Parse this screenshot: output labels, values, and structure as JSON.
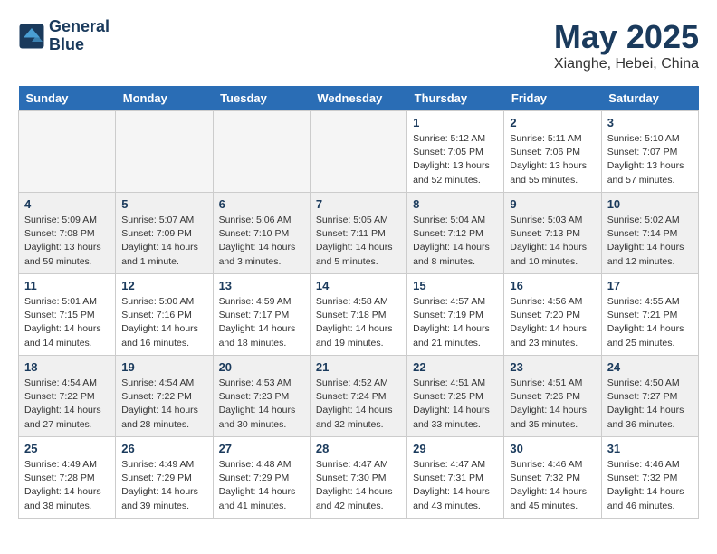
{
  "header": {
    "logo_line1": "General",
    "logo_line2": "Blue",
    "month": "May 2025",
    "location": "Xianghe, Hebei, China"
  },
  "weekdays": [
    "Sunday",
    "Monday",
    "Tuesday",
    "Wednesday",
    "Thursday",
    "Friday",
    "Saturday"
  ],
  "weeks": [
    [
      {
        "day": "",
        "info": ""
      },
      {
        "day": "",
        "info": ""
      },
      {
        "day": "",
        "info": ""
      },
      {
        "day": "",
        "info": ""
      },
      {
        "day": "1",
        "info": "Sunrise: 5:12 AM\nSunset: 7:05 PM\nDaylight: 13 hours\nand 52 minutes."
      },
      {
        "day": "2",
        "info": "Sunrise: 5:11 AM\nSunset: 7:06 PM\nDaylight: 13 hours\nand 55 minutes."
      },
      {
        "day": "3",
        "info": "Sunrise: 5:10 AM\nSunset: 7:07 PM\nDaylight: 13 hours\nand 57 minutes."
      }
    ],
    [
      {
        "day": "4",
        "info": "Sunrise: 5:09 AM\nSunset: 7:08 PM\nDaylight: 13 hours\nand 59 minutes."
      },
      {
        "day": "5",
        "info": "Sunrise: 5:07 AM\nSunset: 7:09 PM\nDaylight: 14 hours\nand 1 minute."
      },
      {
        "day": "6",
        "info": "Sunrise: 5:06 AM\nSunset: 7:10 PM\nDaylight: 14 hours\nand 3 minutes."
      },
      {
        "day": "7",
        "info": "Sunrise: 5:05 AM\nSunset: 7:11 PM\nDaylight: 14 hours\nand 5 minutes."
      },
      {
        "day": "8",
        "info": "Sunrise: 5:04 AM\nSunset: 7:12 PM\nDaylight: 14 hours\nand 8 minutes."
      },
      {
        "day": "9",
        "info": "Sunrise: 5:03 AM\nSunset: 7:13 PM\nDaylight: 14 hours\nand 10 minutes."
      },
      {
        "day": "10",
        "info": "Sunrise: 5:02 AM\nSunset: 7:14 PM\nDaylight: 14 hours\nand 12 minutes."
      }
    ],
    [
      {
        "day": "11",
        "info": "Sunrise: 5:01 AM\nSunset: 7:15 PM\nDaylight: 14 hours\nand 14 minutes."
      },
      {
        "day": "12",
        "info": "Sunrise: 5:00 AM\nSunset: 7:16 PM\nDaylight: 14 hours\nand 16 minutes."
      },
      {
        "day": "13",
        "info": "Sunrise: 4:59 AM\nSunset: 7:17 PM\nDaylight: 14 hours\nand 18 minutes."
      },
      {
        "day": "14",
        "info": "Sunrise: 4:58 AM\nSunset: 7:18 PM\nDaylight: 14 hours\nand 19 minutes."
      },
      {
        "day": "15",
        "info": "Sunrise: 4:57 AM\nSunset: 7:19 PM\nDaylight: 14 hours\nand 21 minutes."
      },
      {
        "day": "16",
        "info": "Sunrise: 4:56 AM\nSunset: 7:20 PM\nDaylight: 14 hours\nand 23 minutes."
      },
      {
        "day": "17",
        "info": "Sunrise: 4:55 AM\nSunset: 7:21 PM\nDaylight: 14 hours\nand 25 minutes."
      }
    ],
    [
      {
        "day": "18",
        "info": "Sunrise: 4:54 AM\nSunset: 7:22 PM\nDaylight: 14 hours\nand 27 minutes."
      },
      {
        "day": "19",
        "info": "Sunrise: 4:54 AM\nSunset: 7:22 PM\nDaylight: 14 hours\nand 28 minutes."
      },
      {
        "day": "20",
        "info": "Sunrise: 4:53 AM\nSunset: 7:23 PM\nDaylight: 14 hours\nand 30 minutes."
      },
      {
        "day": "21",
        "info": "Sunrise: 4:52 AM\nSunset: 7:24 PM\nDaylight: 14 hours\nand 32 minutes."
      },
      {
        "day": "22",
        "info": "Sunrise: 4:51 AM\nSunset: 7:25 PM\nDaylight: 14 hours\nand 33 minutes."
      },
      {
        "day": "23",
        "info": "Sunrise: 4:51 AM\nSunset: 7:26 PM\nDaylight: 14 hours\nand 35 minutes."
      },
      {
        "day": "24",
        "info": "Sunrise: 4:50 AM\nSunset: 7:27 PM\nDaylight: 14 hours\nand 36 minutes."
      }
    ],
    [
      {
        "day": "25",
        "info": "Sunrise: 4:49 AM\nSunset: 7:28 PM\nDaylight: 14 hours\nand 38 minutes."
      },
      {
        "day": "26",
        "info": "Sunrise: 4:49 AM\nSunset: 7:29 PM\nDaylight: 14 hours\nand 39 minutes."
      },
      {
        "day": "27",
        "info": "Sunrise: 4:48 AM\nSunset: 7:29 PM\nDaylight: 14 hours\nand 41 minutes."
      },
      {
        "day": "28",
        "info": "Sunrise: 4:47 AM\nSunset: 7:30 PM\nDaylight: 14 hours\nand 42 minutes."
      },
      {
        "day": "29",
        "info": "Sunrise: 4:47 AM\nSunset: 7:31 PM\nDaylight: 14 hours\nand 43 minutes."
      },
      {
        "day": "30",
        "info": "Sunrise: 4:46 AM\nSunset: 7:32 PM\nDaylight: 14 hours\nand 45 minutes."
      },
      {
        "day": "31",
        "info": "Sunrise: 4:46 AM\nSunset: 7:32 PM\nDaylight: 14 hours\nand 46 minutes."
      }
    ]
  ]
}
